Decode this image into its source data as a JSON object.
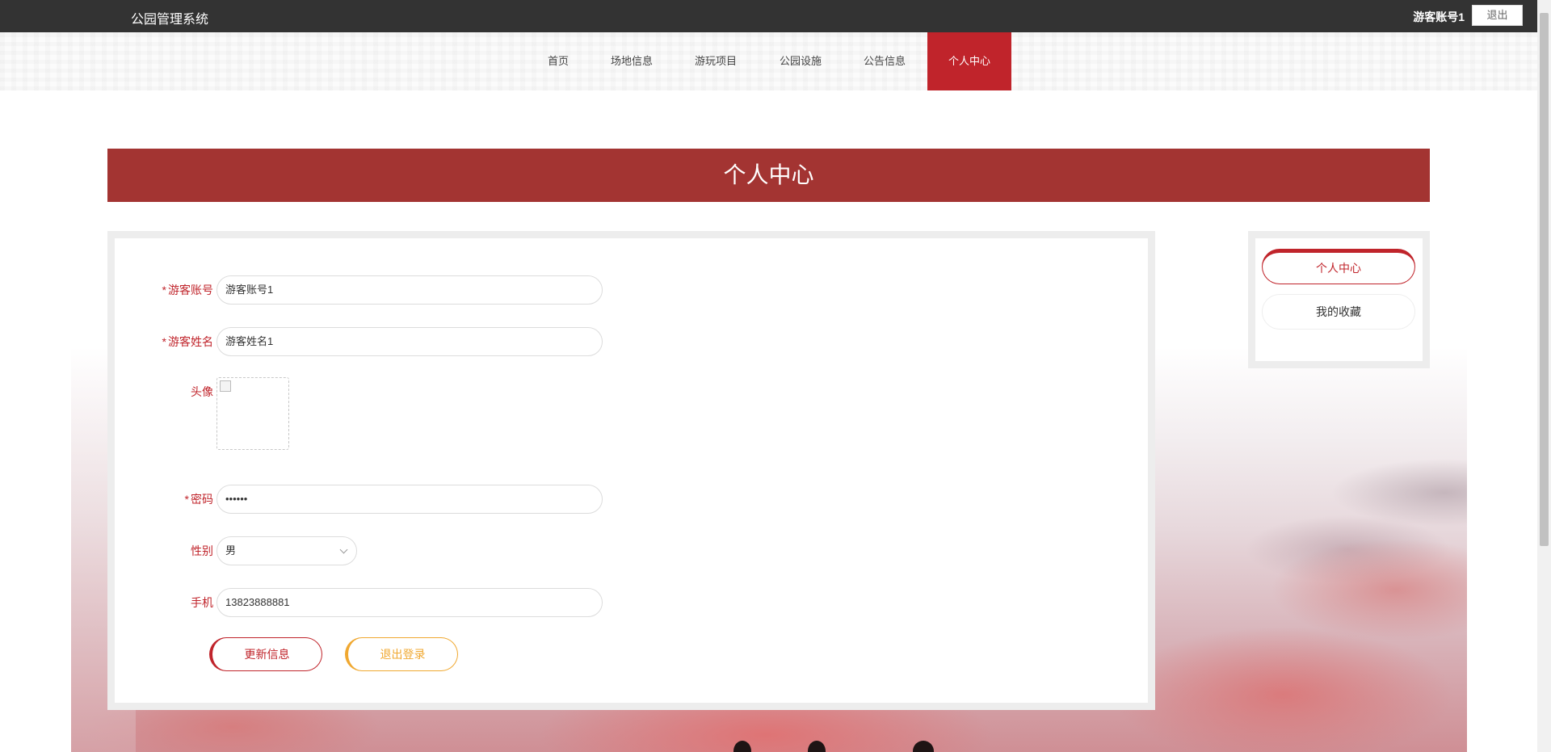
{
  "header": {
    "site_title": "公园管理系统",
    "user_name": "游客账号1",
    "logout_label": "退出"
  },
  "nav": {
    "items": [
      {
        "label": "首页"
      },
      {
        "label": "场地信息"
      },
      {
        "label": "游玩项目"
      },
      {
        "label": "公园设施"
      },
      {
        "label": "公告信息"
      },
      {
        "label": "个人中心",
        "active": true
      }
    ]
  },
  "page": {
    "title": "个人中心"
  },
  "form": {
    "account": {
      "label": "游客账号",
      "value": "游客账号1",
      "required": true
    },
    "name": {
      "label": "游客姓名",
      "value": "游客姓名1",
      "required": true
    },
    "avatar": {
      "label": "头像"
    },
    "password": {
      "label": "密码",
      "value": "••••••",
      "required": true
    },
    "gender": {
      "label": "性别",
      "value": "男"
    },
    "phone": {
      "label": "手机",
      "value": "13823888881"
    },
    "update_button": "更新信息",
    "logout_button": "退出登录",
    "required_mark": "*"
  },
  "side_menu": {
    "items": [
      {
        "label": "个人中心",
        "active": true
      },
      {
        "label": "我的收藏"
      }
    ]
  },
  "colors": {
    "topbar": "#333333",
    "accent": "#c0242b",
    "banner": "#a33432",
    "secondary_button": "#f0a830"
  }
}
